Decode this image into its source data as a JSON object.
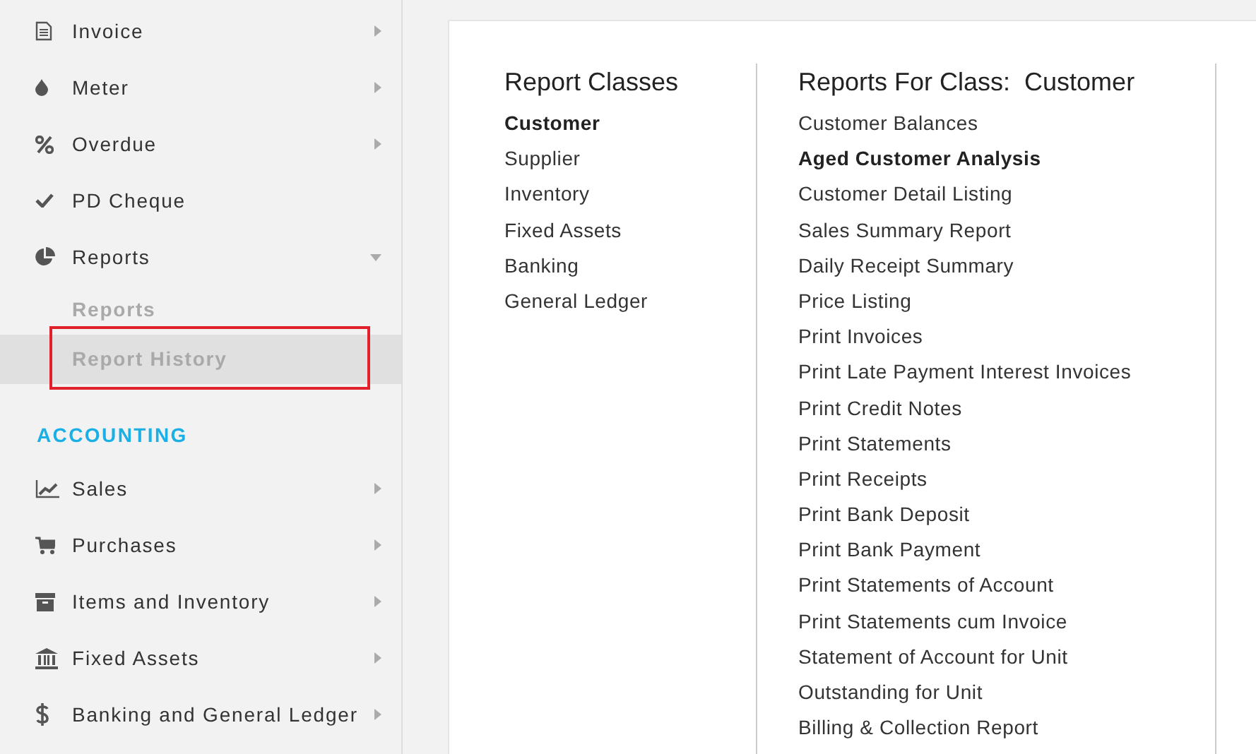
{
  "sidebar": {
    "groups": [
      {
        "items": [
          {
            "label": "Invoice",
            "expanded": false
          },
          {
            "label": "Meter",
            "expanded": false
          },
          {
            "label": "Overdue",
            "expanded": false
          },
          {
            "label": "PD Cheque"
          },
          {
            "label": "Reports",
            "expanded": true,
            "children": [
              {
                "label": "Reports",
                "selected": false
              },
              {
                "label": "Report History",
                "selected": true
              }
            ]
          }
        ]
      },
      {
        "heading": "ACCOUNTING",
        "items": [
          {
            "label": "Sales",
            "expanded": false
          },
          {
            "label": "Purchases",
            "expanded": false
          },
          {
            "label": "Items and Inventory",
            "expanded": false
          },
          {
            "label": "Fixed Assets",
            "expanded": false
          },
          {
            "label": "Banking and General Ledger",
            "expanded": false
          }
        ]
      }
    ]
  },
  "classes": {
    "title": "Report Classes",
    "items": [
      {
        "label": "Customer",
        "selected": true
      },
      {
        "label": "Supplier",
        "selected": false
      },
      {
        "label": "Inventory",
        "selected": false
      },
      {
        "label": "Fixed Assets",
        "selected": false
      },
      {
        "label": "Banking",
        "selected": false
      },
      {
        "label": "General Ledger",
        "selected": false
      }
    ]
  },
  "reports": {
    "title": "Reports For Class:  Customer",
    "items": [
      {
        "label": "Customer Balances",
        "selected": false
      },
      {
        "label": "Aged Customer Analysis",
        "selected": true
      },
      {
        "label": "Customer Detail Listing",
        "selected": false
      },
      {
        "label": "Sales Summary Report",
        "selected": false
      },
      {
        "label": "Daily Receipt Summary",
        "selected": false
      },
      {
        "label": "Price Listing",
        "selected": false
      },
      {
        "label": "Print Invoices",
        "selected": false
      },
      {
        "label": "Print Late Payment Interest Invoices",
        "selected": false
      },
      {
        "label": "Print Credit Notes",
        "selected": false
      },
      {
        "label": "Print Statements",
        "selected": false
      },
      {
        "label": "Print Receipts",
        "selected": false
      },
      {
        "label": "Print Bank Deposit",
        "selected": false
      },
      {
        "label": "Print Bank Payment",
        "selected": false
      },
      {
        "label": "Print Statements of Account",
        "selected": false
      },
      {
        "label": "Print Statements cum Invoice",
        "selected": false
      },
      {
        "label": "Statement of Account for Unit",
        "selected": false
      },
      {
        "label": "Outstanding for Unit",
        "selected": false
      },
      {
        "label": "Billing & Collection Report",
        "selected": false
      }
    ]
  }
}
